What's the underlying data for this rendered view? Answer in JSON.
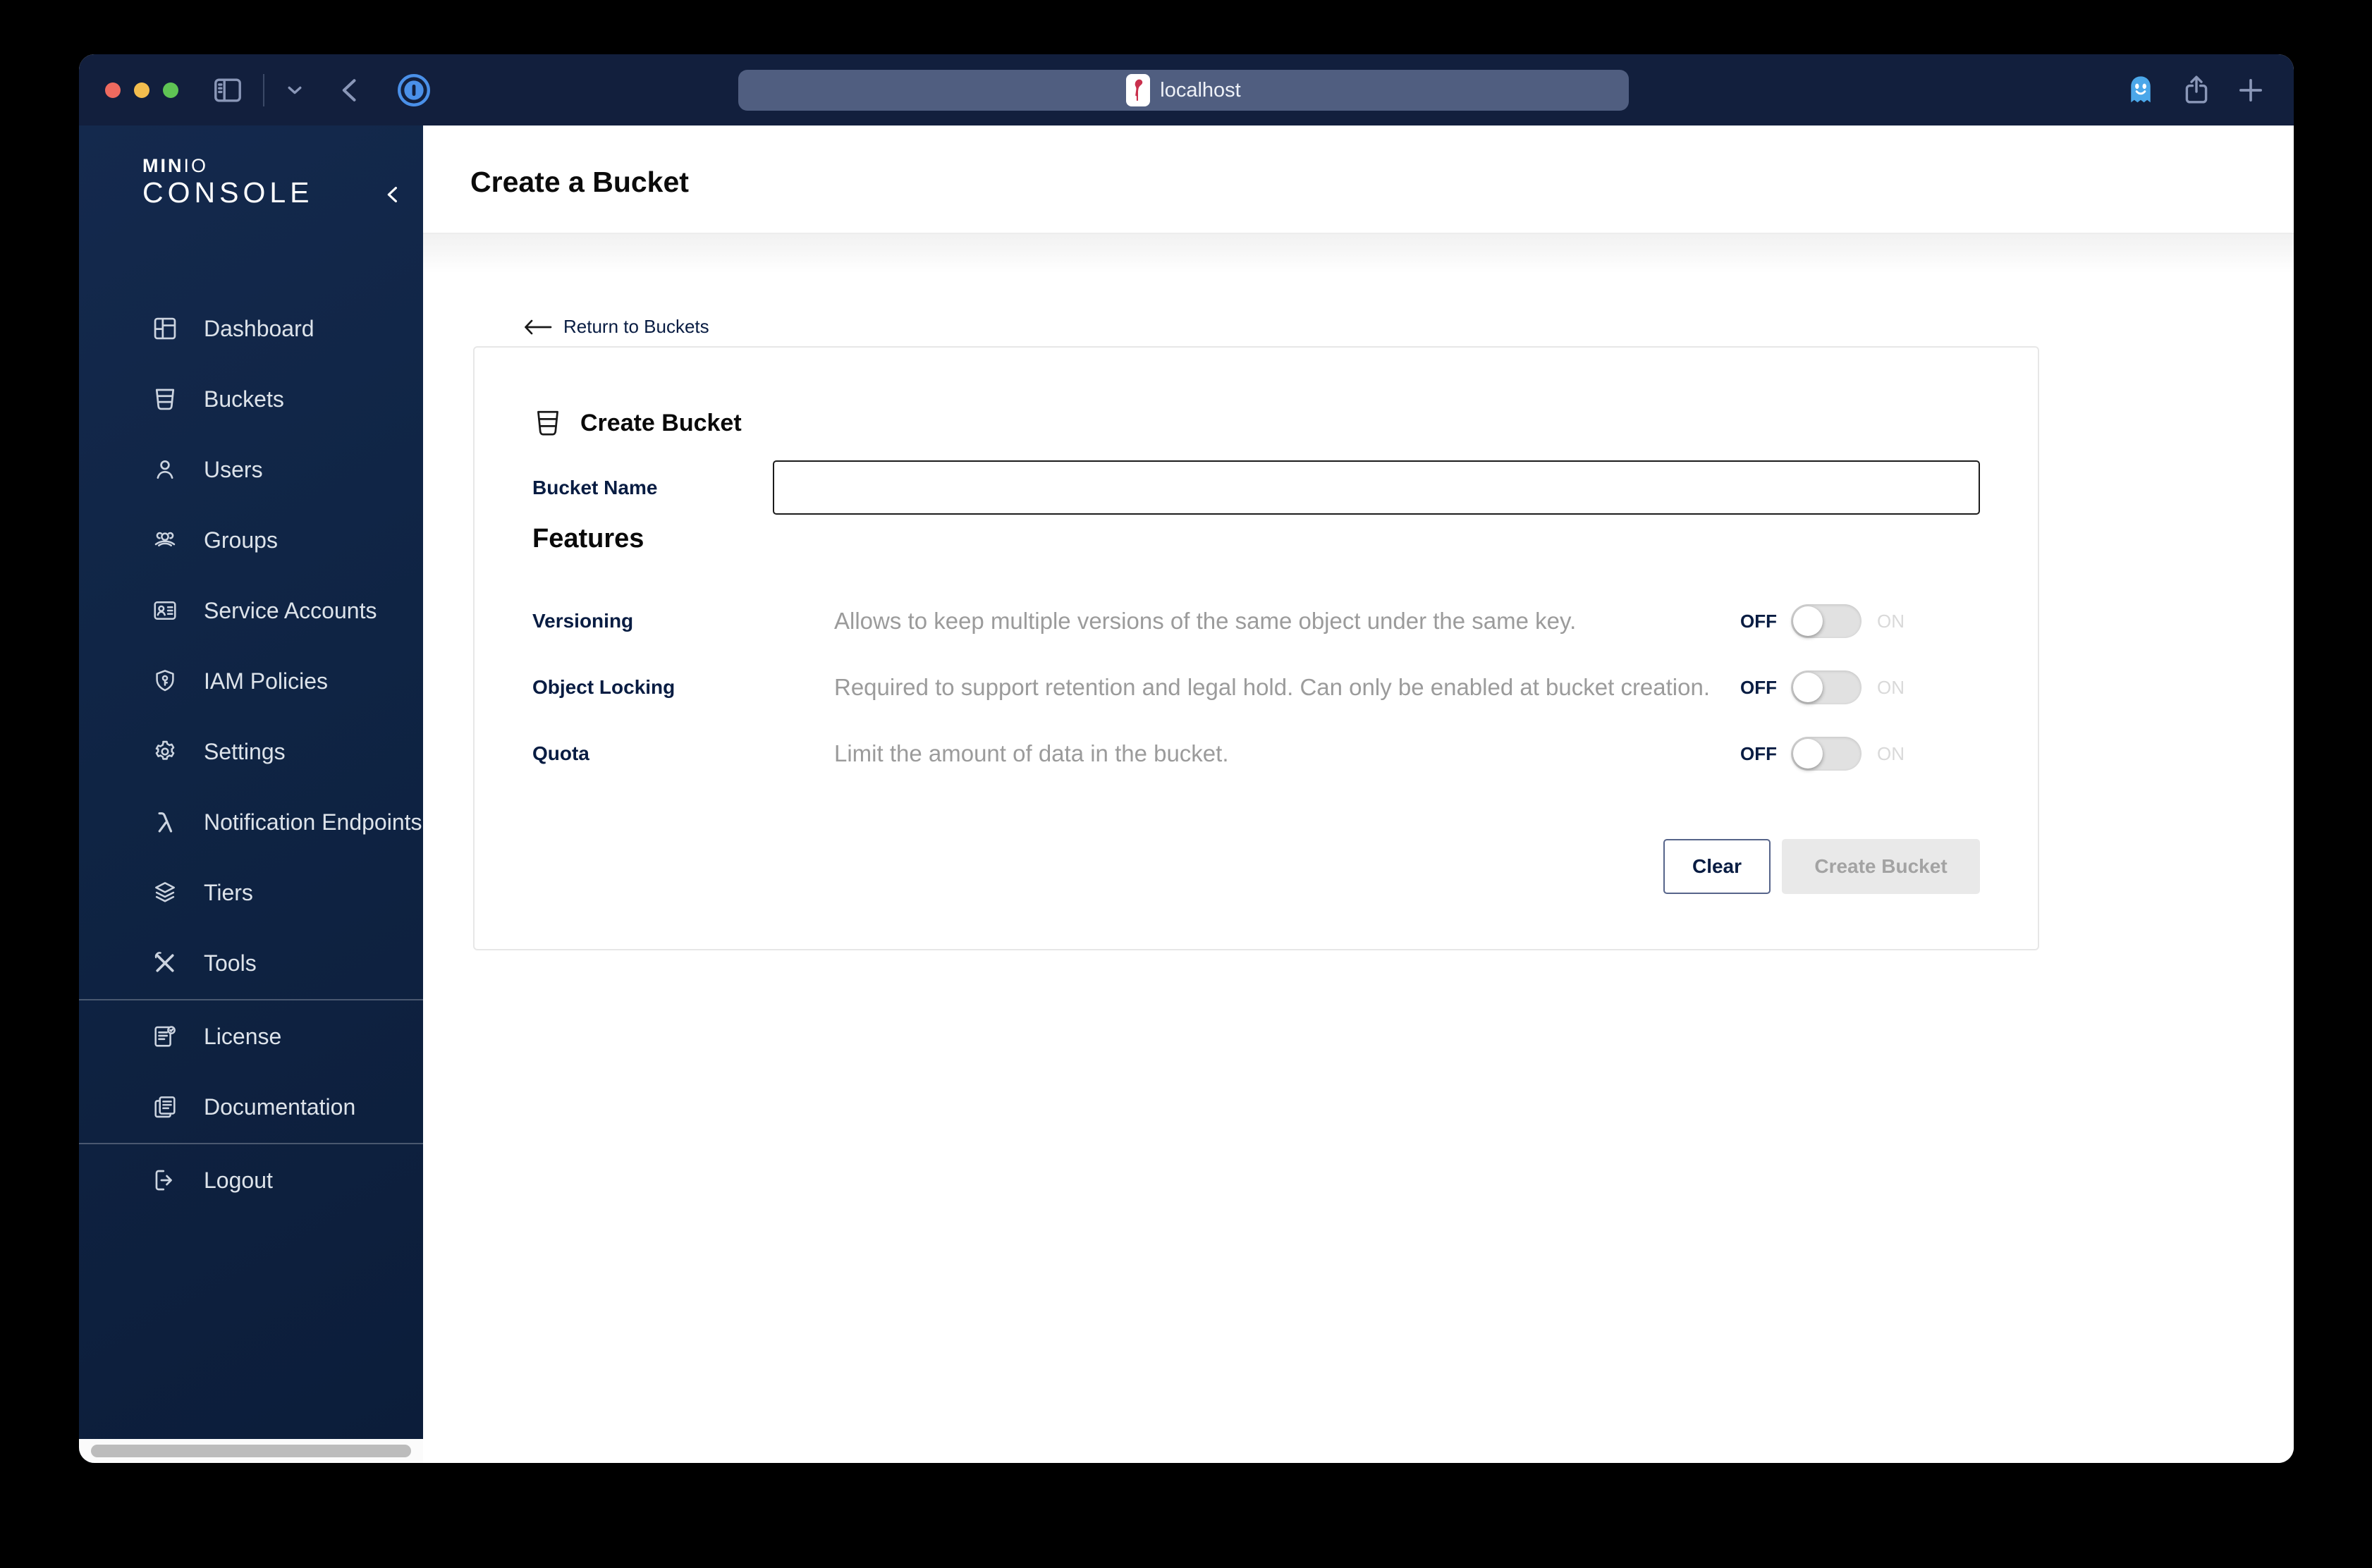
{
  "titlebar": {
    "url": "localhost"
  },
  "sidebar": {
    "logo": {
      "min": "MIN",
      "io": "IO",
      "console": "CONSOLE"
    },
    "items": [
      {
        "label": "Dashboard"
      },
      {
        "label": "Buckets"
      },
      {
        "label": "Users"
      },
      {
        "label": "Groups"
      },
      {
        "label": "Service Accounts"
      },
      {
        "label": "IAM Policies"
      },
      {
        "label": "Settings"
      },
      {
        "label": "Notification Endpoints"
      },
      {
        "label": "Tiers"
      },
      {
        "label": "Tools"
      },
      {
        "label": "License"
      },
      {
        "label": "Documentation"
      },
      {
        "label": "Logout"
      }
    ]
  },
  "header": {
    "title": "Create a Bucket"
  },
  "content": {
    "return_link": "Return to Buckets",
    "card": {
      "title": "Create Bucket",
      "bucket_name": {
        "label": "Bucket Name",
        "value": ""
      },
      "features_title": "Features",
      "features": [
        {
          "label": "Versioning",
          "description": "Allows to keep multiple versions of the same object under the same key.",
          "state": "off"
        },
        {
          "label": "Object Locking",
          "description": "Required to support retention and legal hold. Can only be enabled at bucket creation.",
          "state": "off"
        },
        {
          "label": "Quota",
          "description": "Limit the amount of data in the bucket.",
          "state": "off"
        }
      ],
      "toggle_labels": {
        "off": "OFF",
        "on": "ON"
      },
      "buttons": {
        "clear": "Clear",
        "create": "Create Bucket"
      }
    }
  },
  "colors": {
    "brand_navy": "#081C42",
    "titlebar_bg": "#121f3d",
    "sidebar_gradient_top": "#14294d",
    "sidebar_gradient_bottom": "#0c1d3a",
    "accent_blue": "#4a90e9",
    "toggle_track": "#e1e1e1",
    "disabled_button_bg": "#e9e9e9",
    "disabled_button_text": "#a3a3a3",
    "description_text": "#9b9b9b"
  }
}
